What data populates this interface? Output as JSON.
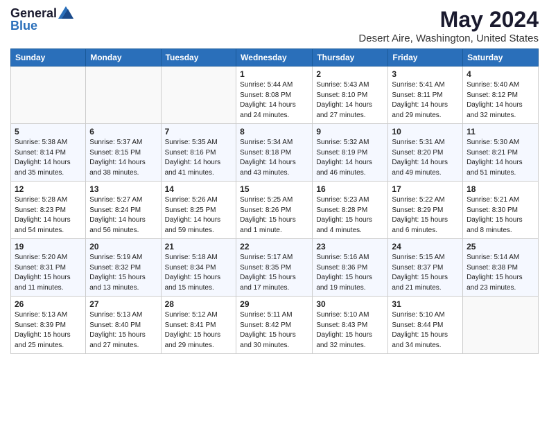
{
  "logo": {
    "general": "General",
    "blue": "Blue"
  },
  "title": "May 2024",
  "subtitle": "Desert Aire, Washington, United States",
  "days_of_week": [
    "Sunday",
    "Monday",
    "Tuesday",
    "Wednesday",
    "Thursday",
    "Friday",
    "Saturday"
  ],
  "weeks": [
    [
      {
        "day": "",
        "sunrise": "",
        "sunset": "",
        "daylight": ""
      },
      {
        "day": "",
        "sunrise": "",
        "sunset": "",
        "daylight": ""
      },
      {
        "day": "",
        "sunrise": "",
        "sunset": "",
        "daylight": ""
      },
      {
        "day": "1",
        "sunrise": "Sunrise: 5:44 AM",
        "sunset": "Sunset: 8:08 PM",
        "daylight": "Daylight: 14 hours and 24 minutes."
      },
      {
        "day": "2",
        "sunrise": "Sunrise: 5:43 AM",
        "sunset": "Sunset: 8:10 PM",
        "daylight": "Daylight: 14 hours and 27 minutes."
      },
      {
        "day": "3",
        "sunrise": "Sunrise: 5:41 AM",
        "sunset": "Sunset: 8:11 PM",
        "daylight": "Daylight: 14 hours and 29 minutes."
      },
      {
        "day": "4",
        "sunrise": "Sunrise: 5:40 AM",
        "sunset": "Sunset: 8:12 PM",
        "daylight": "Daylight: 14 hours and 32 minutes."
      }
    ],
    [
      {
        "day": "5",
        "sunrise": "Sunrise: 5:38 AM",
        "sunset": "Sunset: 8:14 PM",
        "daylight": "Daylight: 14 hours and 35 minutes."
      },
      {
        "day": "6",
        "sunrise": "Sunrise: 5:37 AM",
        "sunset": "Sunset: 8:15 PM",
        "daylight": "Daylight: 14 hours and 38 minutes."
      },
      {
        "day": "7",
        "sunrise": "Sunrise: 5:35 AM",
        "sunset": "Sunset: 8:16 PM",
        "daylight": "Daylight: 14 hours and 41 minutes."
      },
      {
        "day": "8",
        "sunrise": "Sunrise: 5:34 AM",
        "sunset": "Sunset: 8:18 PM",
        "daylight": "Daylight: 14 hours and 43 minutes."
      },
      {
        "day": "9",
        "sunrise": "Sunrise: 5:32 AM",
        "sunset": "Sunset: 8:19 PM",
        "daylight": "Daylight: 14 hours and 46 minutes."
      },
      {
        "day": "10",
        "sunrise": "Sunrise: 5:31 AM",
        "sunset": "Sunset: 8:20 PM",
        "daylight": "Daylight: 14 hours and 49 minutes."
      },
      {
        "day": "11",
        "sunrise": "Sunrise: 5:30 AM",
        "sunset": "Sunset: 8:21 PM",
        "daylight": "Daylight: 14 hours and 51 minutes."
      }
    ],
    [
      {
        "day": "12",
        "sunrise": "Sunrise: 5:28 AM",
        "sunset": "Sunset: 8:23 PM",
        "daylight": "Daylight: 14 hours and 54 minutes."
      },
      {
        "day": "13",
        "sunrise": "Sunrise: 5:27 AM",
        "sunset": "Sunset: 8:24 PM",
        "daylight": "Daylight: 14 hours and 56 minutes."
      },
      {
        "day": "14",
        "sunrise": "Sunrise: 5:26 AM",
        "sunset": "Sunset: 8:25 PM",
        "daylight": "Daylight: 14 hours and 59 minutes."
      },
      {
        "day": "15",
        "sunrise": "Sunrise: 5:25 AM",
        "sunset": "Sunset: 8:26 PM",
        "daylight": "Daylight: 15 hours and 1 minute."
      },
      {
        "day": "16",
        "sunrise": "Sunrise: 5:23 AM",
        "sunset": "Sunset: 8:28 PM",
        "daylight": "Daylight: 15 hours and 4 minutes."
      },
      {
        "day": "17",
        "sunrise": "Sunrise: 5:22 AM",
        "sunset": "Sunset: 8:29 PM",
        "daylight": "Daylight: 15 hours and 6 minutes."
      },
      {
        "day": "18",
        "sunrise": "Sunrise: 5:21 AM",
        "sunset": "Sunset: 8:30 PM",
        "daylight": "Daylight: 15 hours and 8 minutes."
      }
    ],
    [
      {
        "day": "19",
        "sunrise": "Sunrise: 5:20 AM",
        "sunset": "Sunset: 8:31 PM",
        "daylight": "Daylight: 15 hours and 11 minutes."
      },
      {
        "day": "20",
        "sunrise": "Sunrise: 5:19 AM",
        "sunset": "Sunset: 8:32 PM",
        "daylight": "Daylight: 15 hours and 13 minutes."
      },
      {
        "day": "21",
        "sunrise": "Sunrise: 5:18 AM",
        "sunset": "Sunset: 8:34 PM",
        "daylight": "Daylight: 15 hours and 15 minutes."
      },
      {
        "day": "22",
        "sunrise": "Sunrise: 5:17 AM",
        "sunset": "Sunset: 8:35 PM",
        "daylight": "Daylight: 15 hours and 17 minutes."
      },
      {
        "day": "23",
        "sunrise": "Sunrise: 5:16 AM",
        "sunset": "Sunset: 8:36 PM",
        "daylight": "Daylight: 15 hours and 19 minutes."
      },
      {
        "day": "24",
        "sunrise": "Sunrise: 5:15 AM",
        "sunset": "Sunset: 8:37 PM",
        "daylight": "Daylight: 15 hours and 21 minutes."
      },
      {
        "day": "25",
        "sunrise": "Sunrise: 5:14 AM",
        "sunset": "Sunset: 8:38 PM",
        "daylight": "Daylight: 15 hours and 23 minutes."
      }
    ],
    [
      {
        "day": "26",
        "sunrise": "Sunrise: 5:13 AM",
        "sunset": "Sunset: 8:39 PM",
        "daylight": "Daylight: 15 hours and 25 minutes."
      },
      {
        "day": "27",
        "sunrise": "Sunrise: 5:13 AM",
        "sunset": "Sunset: 8:40 PM",
        "daylight": "Daylight: 15 hours and 27 minutes."
      },
      {
        "day": "28",
        "sunrise": "Sunrise: 5:12 AM",
        "sunset": "Sunset: 8:41 PM",
        "daylight": "Daylight: 15 hours and 29 minutes."
      },
      {
        "day": "29",
        "sunrise": "Sunrise: 5:11 AM",
        "sunset": "Sunset: 8:42 PM",
        "daylight": "Daylight: 15 hours and 30 minutes."
      },
      {
        "day": "30",
        "sunrise": "Sunrise: 5:10 AM",
        "sunset": "Sunset: 8:43 PM",
        "daylight": "Daylight: 15 hours and 32 minutes."
      },
      {
        "day": "31",
        "sunrise": "Sunrise: 5:10 AM",
        "sunset": "Sunset: 8:44 PM",
        "daylight": "Daylight: 15 hours and 34 minutes."
      },
      {
        "day": "",
        "sunrise": "",
        "sunset": "",
        "daylight": ""
      }
    ]
  ]
}
